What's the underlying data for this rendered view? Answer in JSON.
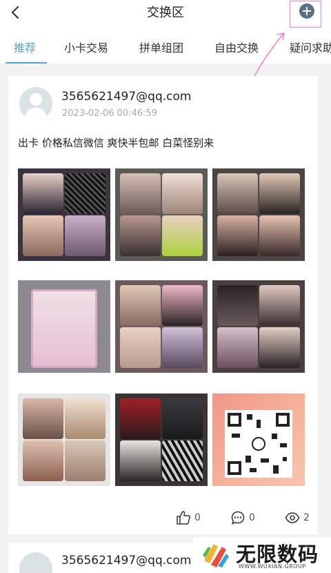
{
  "header": {
    "title": "交换区"
  },
  "tabs": [
    {
      "label": "推荐",
      "active": true
    },
    {
      "label": "小卡交易"
    },
    {
      "label": "拼单组团"
    },
    {
      "label": "自由交换"
    },
    {
      "label": "疑问求助"
    }
  ],
  "posts": [
    {
      "username": "3565621497@qq.com",
      "timestamp": "2023-02-06 00:46:59",
      "text": "出卡 价格私信微信 爽快半包邮 白菜怪别来",
      "likes": "0",
      "comments": "0",
      "views": "2"
    },
    {
      "username": "3565621497@qq.com"
    }
  ],
  "watermark": {
    "title": "无限数码",
    "subtitle": "WWW.WUXIAN.GROUP"
  },
  "colors": {
    "accent": "#5a9fc8",
    "highlight": "#ff7bbd",
    "plus": "#5b6f86"
  }
}
